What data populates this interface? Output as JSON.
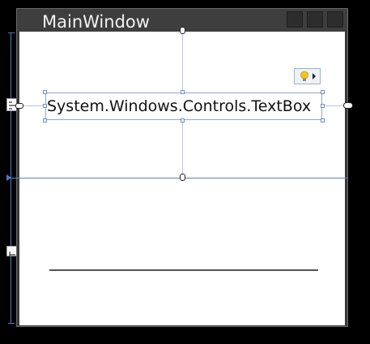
{
  "window": {
    "title": "MainWindow"
  },
  "textbox": {
    "text": "System.Windows.Controls.TextBox"
  },
  "icons": {
    "quick_actions": "lightbulb-icon",
    "dropdown": "triangle-right-icon",
    "anchor": "anchor-icon"
  },
  "colors": {
    "selection": "#8fa8d4",
    "guide": "#bcc6d6",
    "row_line": "#5b83c4",
    "bulb": "#f5c518"
  }
}
